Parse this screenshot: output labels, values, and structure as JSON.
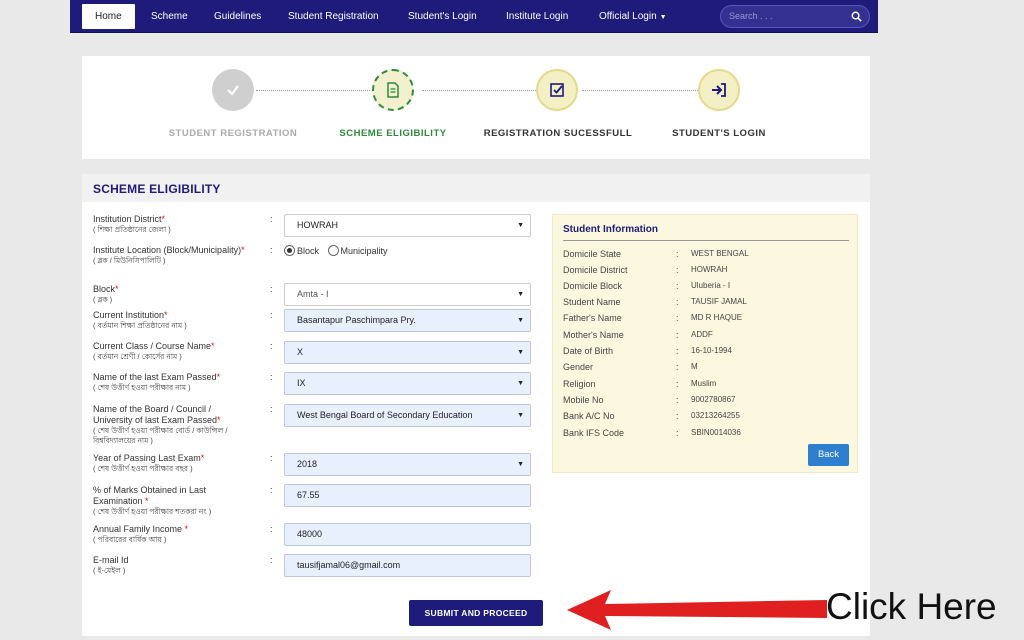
{
  "nav": {
    "items": [
      "Home",
      "Scheme",
      "Guidelines",
      "Student Registration",
      "Student's Login",
      "Institute Login",
      "Official Login"
    ],
    "search_placeholder": "Search . . ."
  },
  "steps": [
    {
      "label": "STUDENT REGISTRATION",
      "icon": "check-icon",
      "state": "done"
    },
    {
      "label": "SCHEME ELIGIBILITY",
      "icon": "document-icon",
      "state": "current"
    },
    {
      "label": "REGISTRATION SUCESSFULL",
      "icon": "checkbox-icon",
      "state": "pending"
    },
    {
      "label": "STUDENT'S LOGIN",
      "icon": "login-icon",
      "state": "pending"
    }
  ],
  "form": {
    "title": "SCHEME ELIGIBILITY",
    "fields": [
      {
        "label": "Institution District",
        "sub": "( শিক্ষা প্রতিষ্ঠানের জেলা )",
        "value": "HOWRAH"
      },
      {
        "label": "Institute Location (Block/Municipality)",
        "sub": "( ব্লক / মিউনিসিপালিটি )"
      },
      {
        "label": "Block",
        "sub": "( ব্লক )",
        "value": "Amta - I"
      },
      {
        "label": "Current Institution",
        "sub": "( বর্তমান শিক্ষা প্রতিষ্ঠানের নাম )",
        "value": "Basantapur Paschimpara Pry."
      },
      {
        "label": "Current Class / Course Name",
        "sub": "( বর্তমান শ্রেণী / কোর্সের নাম )",
        "value": "X"
      },
      {
        "label": "Name of the last Exam Passed",
        "sub": "( শেষ উত্তীর্ণ হওয়া পরীক্ষার নাম )",
        "value": "IX"
      },
      {
        "label": "Name of the Board / Council / University of last Exam Passed",
        "sub": "( শেষ উত্তীর্ণ হওয়া পরীক্ষার বোর্ড / কাউন্সিল / বিশ্ববিদ্যালয়ের নাম )",
        "value": "West Bengal Board of Secondary Education"
      },
      {
        "label": "Year of Passing Last Exam",
        "sub": "( শেষ উত্তীর্ণ হওয়া পরীক্ষার বছর )",
        "value": "2018"
      },
      {
        "label": "% of Marks Obtained in Last Examination",
        "sub": "( শেষ উত্তীর্ণ হওয়া পরীক্ষার শতকরা নং )",
        "value": "67.55"
      },
      {
        "label": "Annual Family Income",
        "sub": "( পরিবারের বার্ষিক আয় )",
        "value": "48000"
      },
      {
        "label": "E-mail Id",
        "sub": "( ই-মেইল )",
        "value": "tausifjamal06@gmail.com"
      }
    ],
    "location_options": [
      "Block",
      "Municipality"
    ],
    "location_selected": "Block",
    "submit_label": "SUBMIT AND PROCEED"
  },
  "student_info": {
    "title": "Student Information",
    "rows": [
      {
        "key": "Domicile State",
        "value": "WEST BENGAL"
      },
      {
        "key": "Domicile District",
        "value": "HOWRAH"
      },
      {
        "key": "Domicile Block",
        "value": "Uluberia - I"
      },
      {
        "key": "Student Name",
        "value": "TAUSIF JAMAL"
      },
      {
        "key": "Father's Name",
        "value": "MD R HAQUE"
      },
      {
        "key": "Mother's Name",
        "value": "ADDF"
      },
      {
        "key": "Date of Birth",
        "value": "16-10-1994"
      },
      {
        "key": "Gender",
        "value": "M"
      },
      {
        "key": "Religion",
        "value": "Muslim"
      },
      {
        "key": "Mobile No",
        "value": "9002780867"
      },
      {
        "key": "Bank A/C No",
        "value": "03213264255"
      },
      {
        "key": "Bank IFS Code",
        "value": "SBIN0014036"
      }
    ],
    "back_label": "Back"
  },
  "annotation": {
    "text": "Click Here",
    "color": "#e02020"
  },
  "colors": {
    "nav": "#1e1b7a",
    "current_step": "#2e8b3a",
    "accent": "#1e1b7a"
  }
}
